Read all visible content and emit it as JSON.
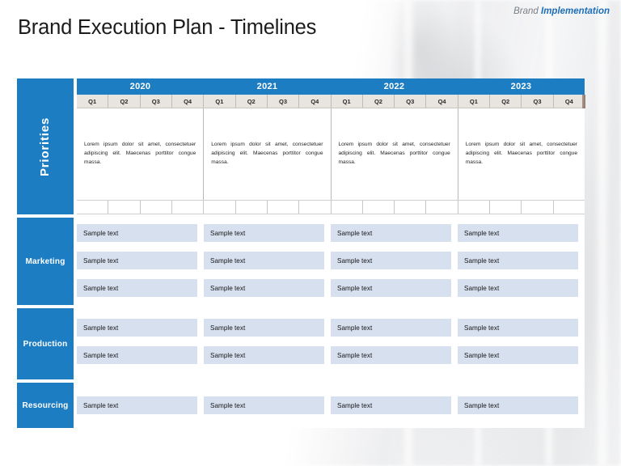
{
  "header": {
    "title": "Brand Execution Plan - Timelines",
    "brand_word": "Brand",
    "brand_accent_word": "Implementation"
  },
  "colors": {
    "primary_blue": "#1d7dc2",
    "bar_fill": "#d7e0ef",
    "quarter_header": "#e8e4e0",
    "accent_text_blue": "#1d6fb8"
  },
  "timeline": {
    "years": [
      "2020",
      "2021",
      "2022",
      "2023"
    ],
    "quarters": [
      "Q1",
      "Q2",
      "Q3",
      "Q4"
    ]
  },
  "rows": {
    "priorities": {
      "label": "Priorities",
      "cells": [
        "Lorem ipsum dolor sit amet, consectetuer adipiscing elit. Maecenas porttitor congue massa.",
        "Lorem ipsum dolor sit amet, consectetuer adipiscing elit. Maecenas porttitor congue massa.",
        "Lorem ipsum dolor sit amet, consectetuer adipiscing elit. Maecenas porttitor congue massa.",
        "Lorem ipsum dolor sit amet, consectetuer adipiscing elit. Maecenas porttitor congue massa."
      ]
    },
    "marketing": {
      "label": "Marketing",
      "bars": [
        [
          "Sample text",
          "Sample text",
          "Sample text",
          "Sample text"
        ],
        [
          "Sample text",
          "Sample text",
          "Sample text",
          "Sample text"
        ],
        [
          "Sample text",
          "Sample text",
          "Sample text",
          "Sample text"
        ]
      ]
    },
    "production": {
      "label": "Production",
      "bars": [
        [
          "Sample text",
          "Sample text",
          "Sample text",
          "Sample text"
        ],
        [
          "Sample text",
          "Sample text",
          "Sample text",
          "Sample text"
        ]
      ]
    },
    "resourcing": {
      "label": "Resourcing",
      "bars": [
        [
          "Sample text",
          "Sample text",
          "Sample text",
          "Sample text"
        ]
      ]
    }
  }
}
